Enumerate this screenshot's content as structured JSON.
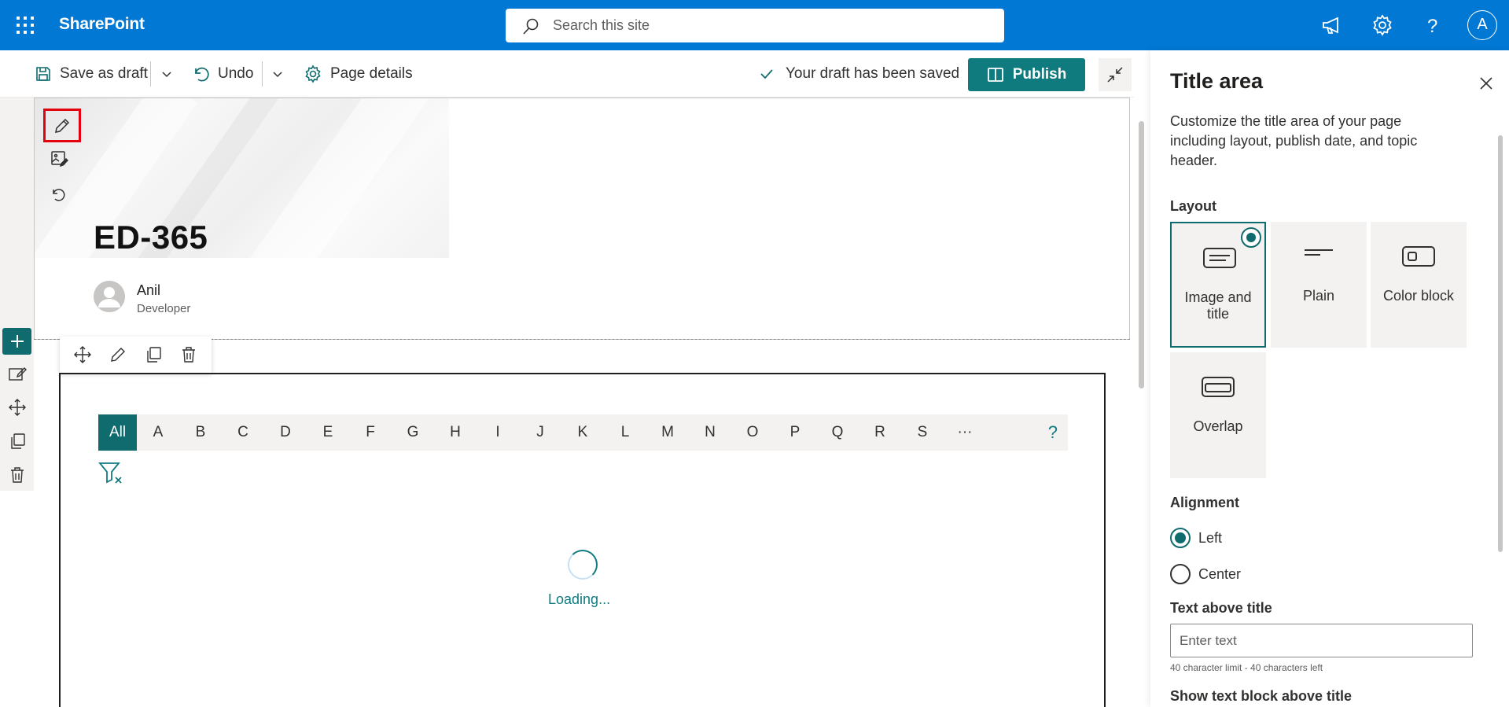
{
  "suite": {
    "app_name": "SharePoint",
    "search_placeholder": "Search this site",
    "avatar_initial": "A"
  },
  "commandbar": {
    "save_draft": "Save as draft",
    "undo": "Undo",
    "page_details": "Page details",
    "status": "Your draft has been saved",
    "publish": "Publish"
  },
  "page": {
    "title": "ED-365",
    "author_name": "Anil",
    "author_role": "Developer"
  },
  "az_filter": {
    "letters": [
      "All",
      "A",
      "B",
      "C",
      "D",
      "E",
      "F",
      "G",
      "H",
      "I",
      "J",
      "K",
      "L",
      "M",
      "N",
      "O",
      "P",
      "Q",
      "R",
      "S",
      "···"
    ],
    "help": "?"
  },
  "loading_text": "Loading...",
  "panel": {
    "title": "Title area",
    "description": "Customize the title area of your page including layout, publish date, and topic header.",
    "layout_label": "Layout",
    "layouts": [
      {
        "label": "Image and title",
        "selected": true
      },
      {
        "label": "Plain",
        "selected": false
      },
      {
        "label": "Color block",
        "selected": false
      },
      {
        "label": "Overlap",
        "selected": false
      }
    ],
    "alignment_label": "Alignment",
    "alignment_left": "Left",
    "alignment_center": "Center",
    "text_above_label": "Text above title",
    "text_above_placeholder": "Enter text",
    "text_above_hint": "40 character limit - 40 characters left",
    "show_text_block_label": "Show text block above title"
  },
  "colors": {
    "suite_blue": "#0078d4",
    "teal": "#0f6b6e",
    "highlight_red": "#e3000f"
  }
}
